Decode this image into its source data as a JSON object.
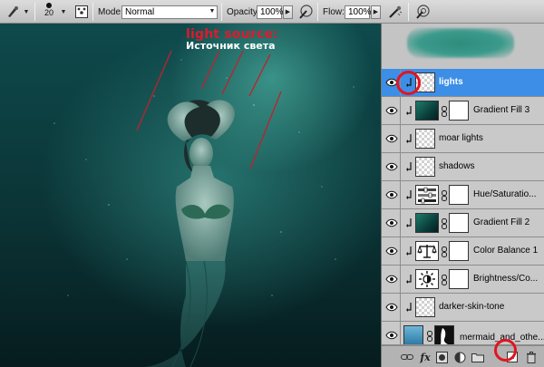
{
  "options_bar": {
    "brush_size": "20",
    "mode_label": "Mode:",
    "mode_value": "Normal",
    "opacity_label": "Opacity:",
    "opacity_value": "100%",
    "flow_label": "Flow:",
    "flow_value": "100%"
  },
  "canvas": {
    "annotation_en": "light source:",
    "annotation_ru": "Источник света"
  },
  "layers_panel": {
    "layers": [
      {
        "name": "lights",
        "selected": true,
        "thumb": "checker",
        "has_mask": false
      },
      {
        "name": "Gradient Fill 3",
        "selected": false,
        "thumb": "gradient",
        "has_mask": true
      },
      {
        "name": "moar lights",
        "selected": false,
        "thumb": "checker",
        "has_mask": false
      },
      {
        "name": "shadows",
        "selected": false,
        "thumb": "checker",
        "has_mask": false
      },
      {
        "name": "Hue/Saturatio...",
        "selected": false,
        "thumb": "hue-sat-icon",
        "has_mask": true
      },
      {
        "name": "Gradient Fill 2",
        "selected": false,
        "thumb": "gradient",
        "has_mask": true
      },
      {
        "name": "Color Balance 1",
        "selected": false,
        "thumb": "balance-scale-icon",
        "has_mask": true
      },
      {
        "name": "Brightness/Co...",
        "selected": false,
        "thumb": "sun-icon",
        "has_mask": true
      },
      {
        "name": "darker-skin-tone",
        "selected": false,
        "thumb": "checker",
        "has_mask": false
      },
      {
        "name": "mermaid_and_othe...",
        "selected": false,
        "thumb": "photo",
        "has_mask": true
      }
    ]
  },
  "colors": {
    "selection": "#3d8ee6",
    "annotation_red": "#e0192b",
    "highlight_ring": "#e3141f"
  }
}
